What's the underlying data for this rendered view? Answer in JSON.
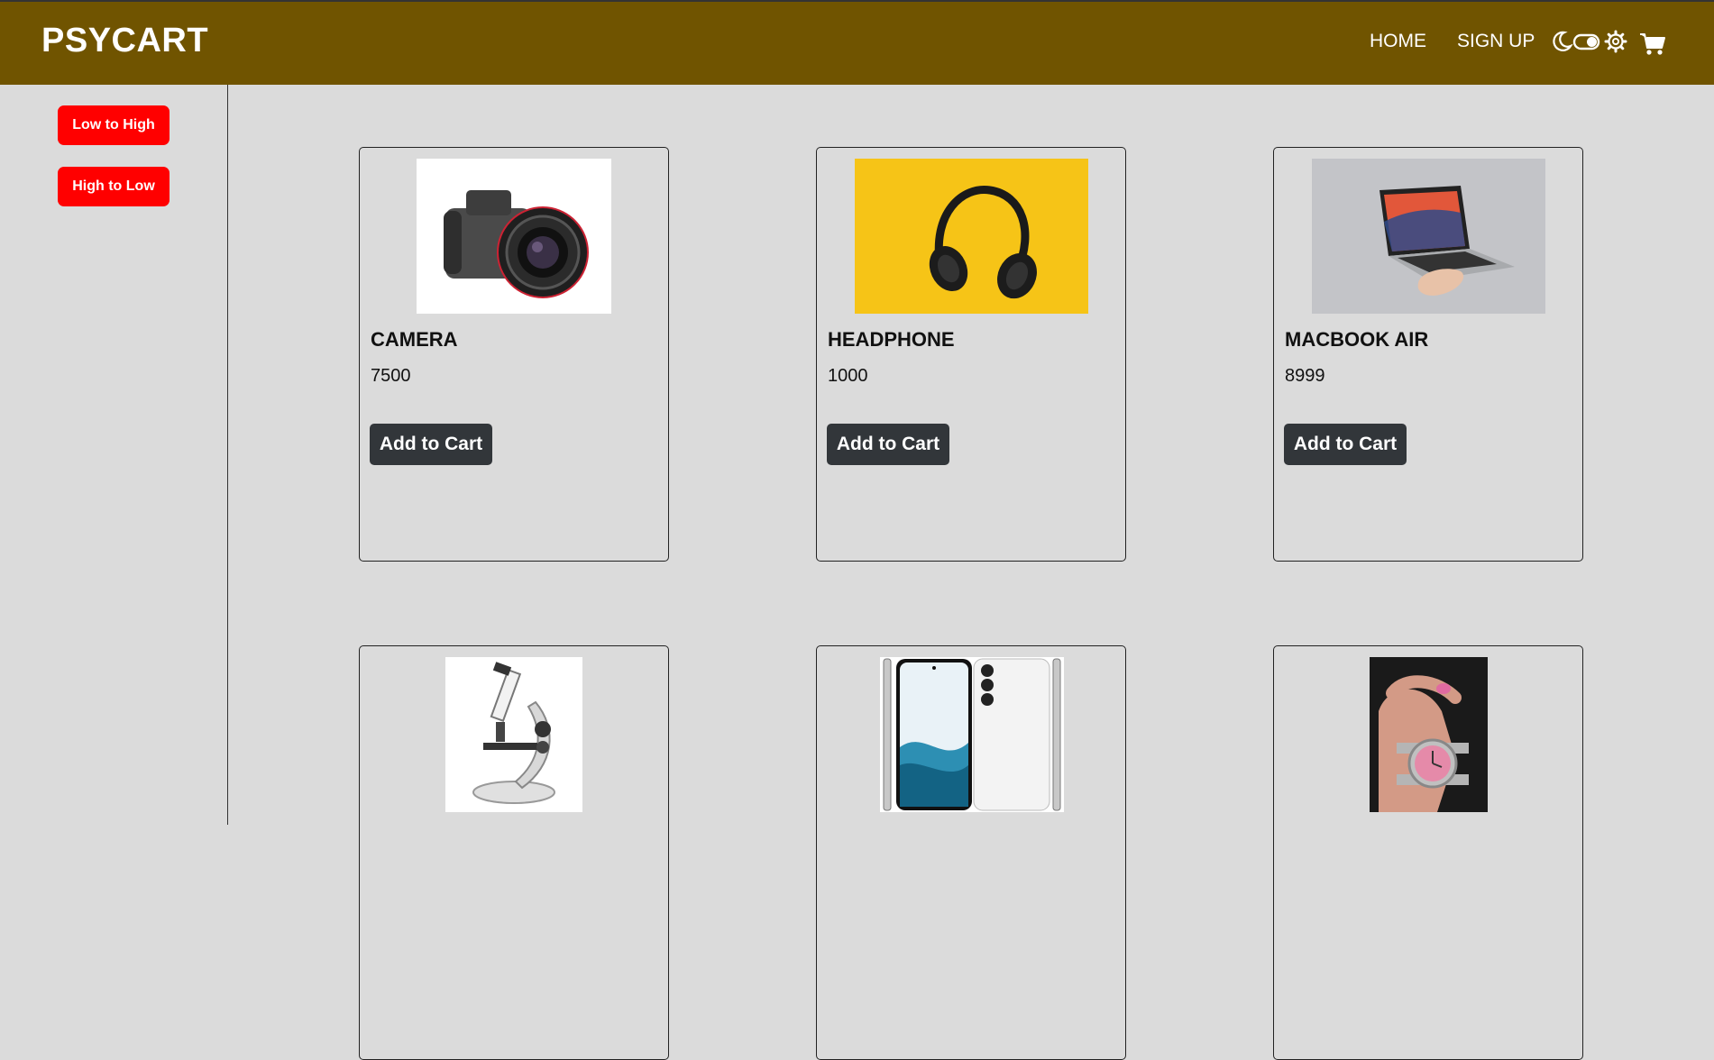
{
  "header": {
    "brand": "PSYCART",
    "nav_home": "HOME",
    "nav_signup": "SIGN UP",
    "icons": [
      "moon-icon",
      "toggle-icon",
      "gear-icon",
      "cart-icon"
    ],
    "background_color": "#705400"
  },
  "sidebar": {
    "sort_low_label": "Low to High",
    "sort_high_label": "High to Low",
    "button_color": "#ff0000"
  },
  "products": [
    {
      "name": "CAMERA",
      "price": "7500",
      "button": "Add to Cart",
      "image": "camera"
    },
    {
      "name": "HEADPHONE",
      "price": "1000",
      "button": "Add to Cart",
      "image": "headphone"
    },
    {
      "name": "MACBOOK AIR",
      "price": "8999",
      "button": "Add to Cart",
      "image": "laptop"
    },
    {
      "image": "microscope"
    },
    {
      "image": "smartphone"
    },
    {
      "image": "wristwatch"
    }
  ]
}
